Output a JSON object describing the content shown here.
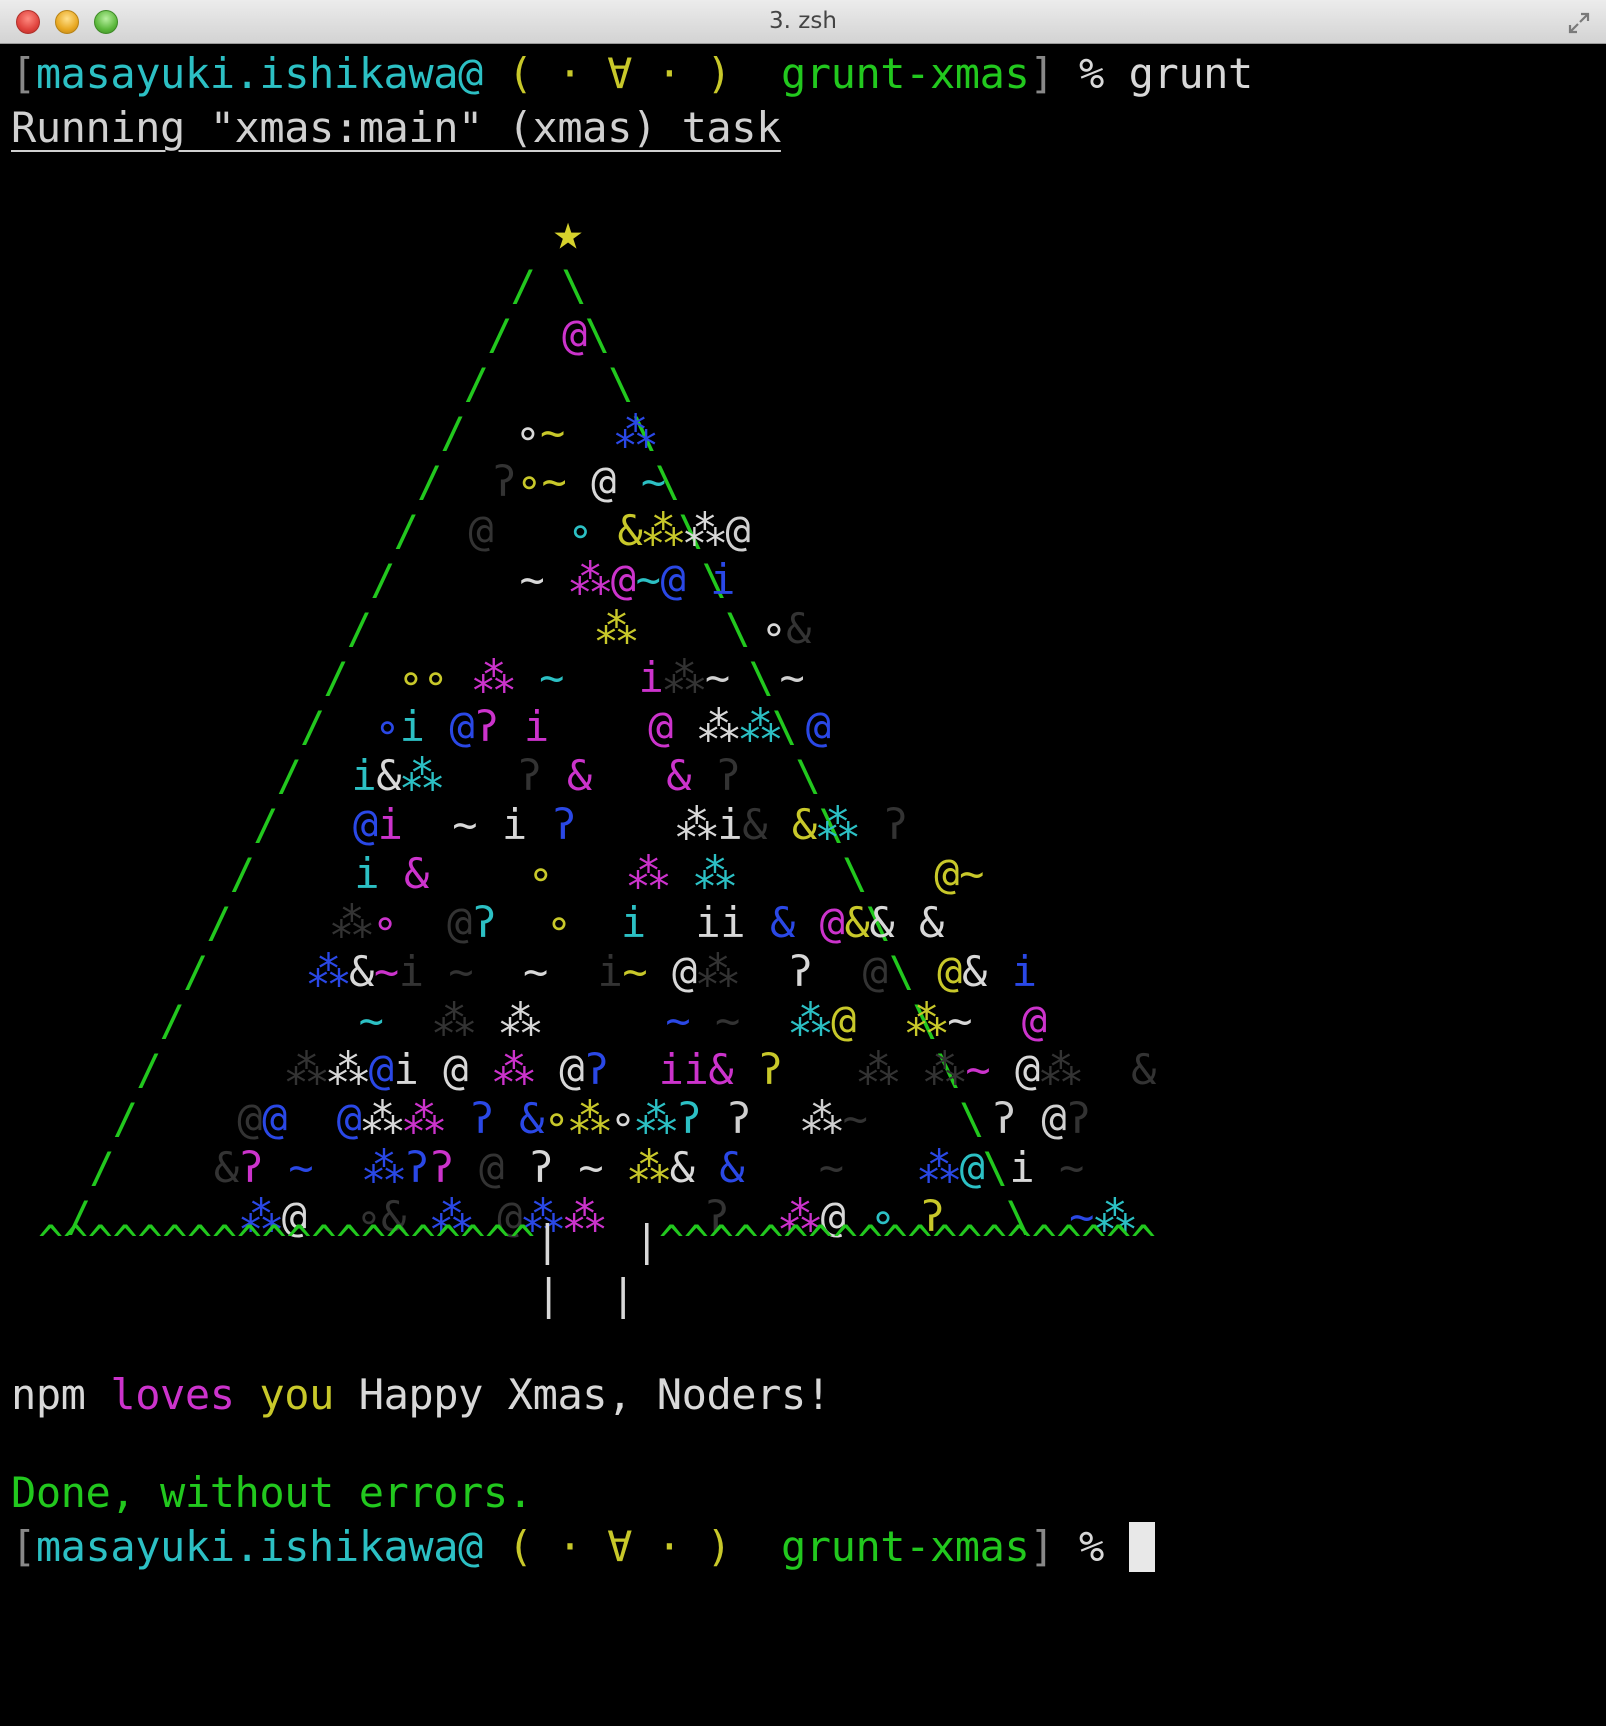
{
  "window": {
    "title": "3. zsh"
  },
  "prompt": {
    "open": "[",
    "user": "masayuki.ishikawa@",
    "face": " ( · ∀ · ) ",
    "dir": " grunt-xmas",
    "close": "]",
    "symbol": " % ",
    "command": "grunt"
  },
  "task_line": "Running \"xmas:main\" (xmas) task",
  "tree": {
    "star": "★",
    "left_base": "^^^^^^^^^^^^^^^^^^^^",
    "right_base": "^^^^^^^^^^^^^^^^^^^^",
    "trunk": "|  |"
  },
  "message": {
    "npm": "npm",
    "loves": "loves",
    "you": "you",
    "rest": "Happy Xmas, Noders!"
  },
  "done": "Done, without errors.",
  "colors": {
    "green": "#22c81e",
    "cyan": "#2cc0c4",
    "magenta": "#cc33cc",
    "yellow": "#c8c82a",
    "blue": "#2a48e6",
    "white": "#d8d8d8",
    "dim": "#333333"
  }
}
